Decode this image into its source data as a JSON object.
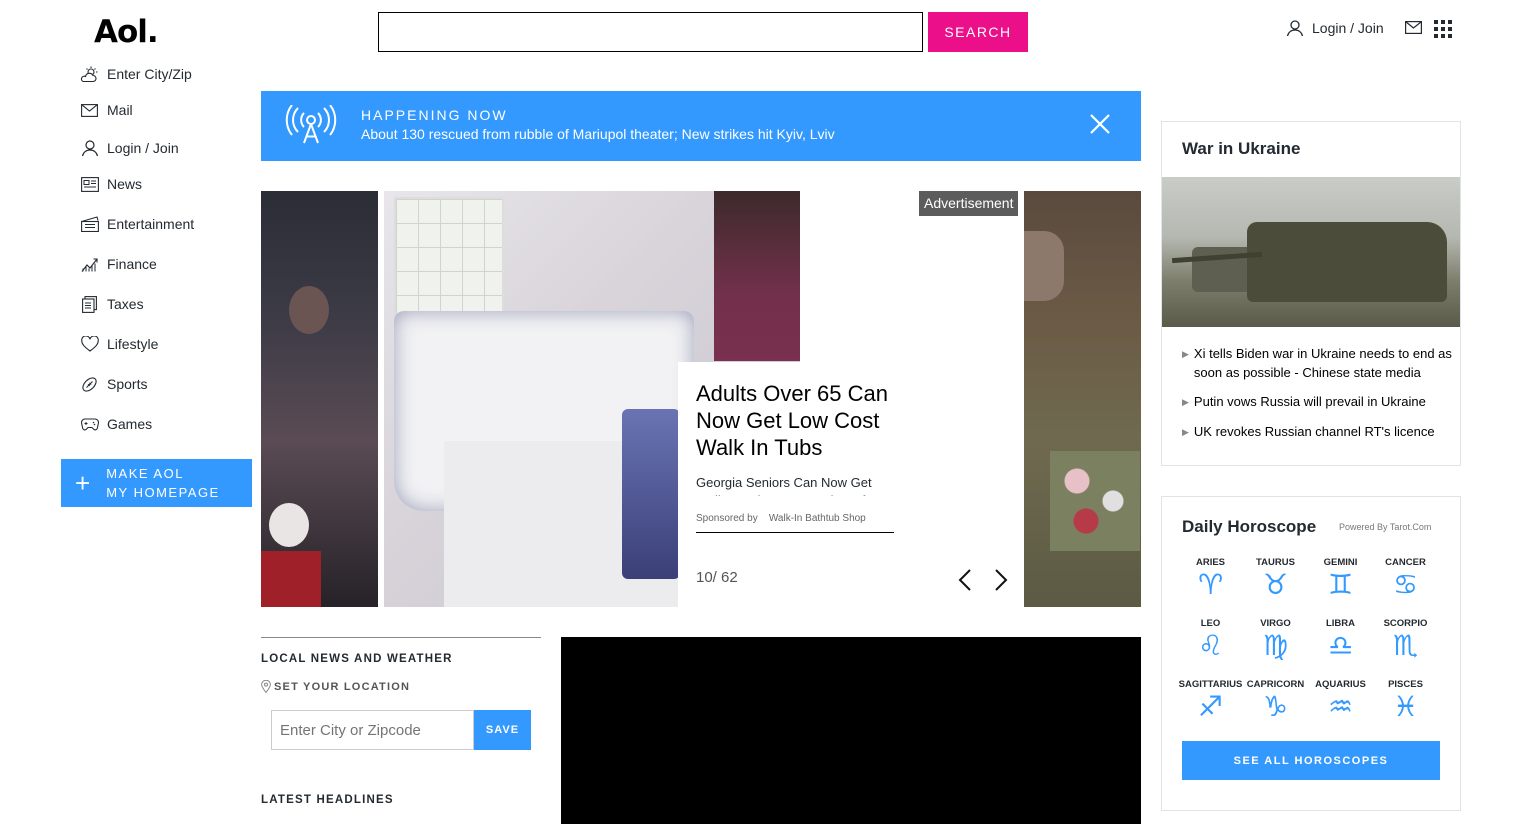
{
  "header": {
    "logo": "Aol.",
    "search_value": "",
    "search_button": "SEARCH",
    "login_label": "Login / Join"
  },
  "sidebar": {
    "items": [
      {
        "label": "Enter City/Zip",
        "icon": "weather-icon"
      },
      {
        "label": "Mail",
        "icon": "mail-icon"
      },
      {
        "label": "Login / Join",
        "icon": "user-icon"
      },
      {
        "label": "News",
        "icon": "news-icon"
      },
      {
        "label": "Entertainment",
        "icon": "clapper-icon"
      },
      {
        "label": "Finance",
        "icon": "chart-icon"
      },
      {
        "label": "Taxes",
        "icon": "document-icon"
      },
      {
        "label": "Lifestyle",
        "icon": "heart-icon"
      },
      {
        "label": "Sports",
        "icon": "football-icon"
      },
      {
        "label": "Games",
        "icon": "gamepad-icon"
      }
    ],
    "homepage_line1": "MAKE AOL",
    "homepage_line2": "MY HOMEPAGE"
  },
  "happening": {
    "label": "HAPPENING NOW",
    "text": "About 130 rescued from rubble of Mariupol theater; New strikes hit Kyiv, Lviv"
  },
  "carousel": {
    "ad_title": "Adults Over 65 Can Now Get Low Cost Walk In Tubs",
    "ad_description": "Georgia Seniors Can Now Get Walk-In Tubs At A Fraction Of",
    "sponsored_by": "Sponsored by",
    "sponsor": "Walk-In Bathtub Shop",
    "counter": "10/ 62",
    "ad_badge": "Advertisement"
  },
  "local": {
    "heading": "LOCAL NEWS AND WEATHER",
    "set_location": "SET YOUR LOCATION",
    "zip_placeholder": "Enter City or Zipcode",
    "save": "SAVE",
    "latest": "LATEST HEADLINES"
  },
  "war": {
    "title": "War in Ukraine",
    "headlines": [
      "Xi tells Biden war in Ukraine needs to end as soon as possible - Chinese state media",
      "Putin vows Russia will prevail in Ukraine",
      "UK revokes Russian channel RT's licence"
    ]
  },
  "horoscope": {
    "title": "Daily Horoscope",
    "powered": "Powered By Tarot.Com",
    "signs": [
      {
        "name": "ARIES",
        "glyph": "♈︎"
      },
      {
        "name": "TAURUS",
        "glyph": "♉︎"
      },
      {
        "name": "GEMINI",
        "glyph": "♊︎"
      },
      {
        "name": "CANCER",
        "glyph": "♋︎"
      },
      {
        "name": "LEO",
        "glyph": "♌︎"
      },
      {
        "name": "VIRGO",
        "glyph": "♍︎"
      },
      {
        "name": "LIBRA",
        "glyph": "♎︎"
      },
      {
        "name": "SCORPIO",
        "glyph": "♏︎"
      },
      {
        "name": "SAGITTARIUS",
        "glyph": "♐︎"
      },
      {
        "name": "CAPRICORN",
        "glyph": "♑︎"
      },
      {
        "name": "AQUARIUS",
        "glyph": "♒︎"
      },
      {
        "name": "PISCES",
        "glyph": "♓︎"
      }
    ],
    "button": "SEE ALL HOROSCOPES"
  },
  "colors": {
    "accent": "#3399ff",
    "search_button": "#eb0f8a"
  }
}
